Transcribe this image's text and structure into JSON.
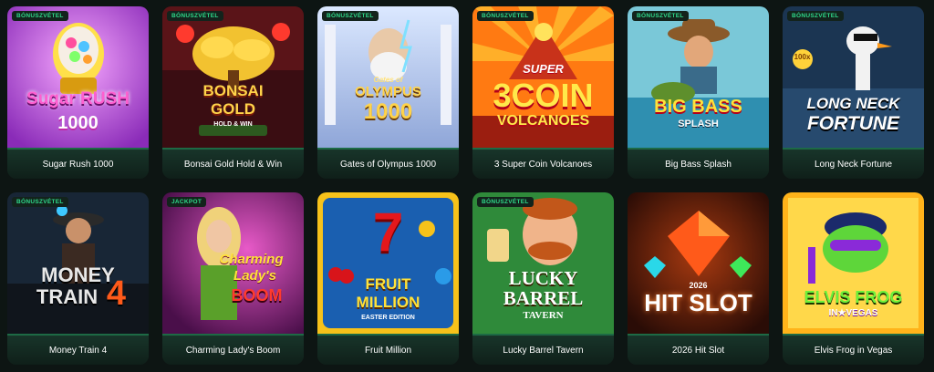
{
  "games": [
    {
      "title": "Sugar Rush 1000",
      "badge": "BÓNUSZVÉTEL",
      "logo_lines": [
        "Sugar RUSH",
        "1000"
      ]
    },
    {
      "title": "Bonsai Gold Hold & Win",
      "badge": "BÓNUSZVÉTEL",
      "logo_lines": [
        "BONSAI",
        "GOLD",
        "HOLD & WIN"
      ]
    },
    {
      "title": "Gates of Olympus 1000",
      "badge": "BÓNUSZVÉTEL",
      "logo_lines": [
        "Gates of",
        "OLYMPUS",
        "1000"
      ]
    },
    {
      "title": "3 Super Coin Volcanoes",
      "badge": "BÓNUSZVÉTEL",
      "logo_lines": [
        "SUPER",
        "3COIN",
        "VOLCANOES"
      ]
    },
    {
      "title": "Big Bass Splash",
      "badge": "BÓNUSZVÉTEL",
      "logo_lines": [
        "BIG BASS",
        "SPLASH"
      ]
    },
    {
      "title": "Long Neck Fortune",
      "badge": "BÓNUSZVÉTEL",
      "logo_lines": [
        "100x",
        "LONG NECK",
        "FORTUNE"
      ]
    },
    {
      "title": "Money Train 4",
      "badge": "BÓNUSZVÉTEL",
      "logo_lines": [
        "MONEY",
        "TRAIN",
        "4"
      ]
    },
    {
      "title": "Charming Lady's Boom",
      "badge": "JACKPOT",
      "logo_lines": [
        "Charming",
        "Lady's",
        "BOOM"
      ]
    },
    {
      "title": "Fruit Million",
      "badge": "",
      "logo_lines": [
        "7",
        "FRUIT",
        "MILLION",
        "EASTER EDITION"
      ]
    },
    {
      "title": "Lucky Barrel Tavern",
      "badge": "BÓNUSZVÉTEL",
      "logo_lines": [
        "LUCKY",
        "BARREL",
        "TAVERN"
      ]
    },
    {
      "title": "2026 Hit Slot",
      "badge": "",
      "logo_lines": [
        "2026",
        "HIT SLOT"
      ]
    },
    {
      "title": "Elvis Frog in Vegas",
      "badge": "",
      "logo_lines": [
        "ELVIS FROG",
        "IN★VEGAS"
      ]
    }
  ]
}
